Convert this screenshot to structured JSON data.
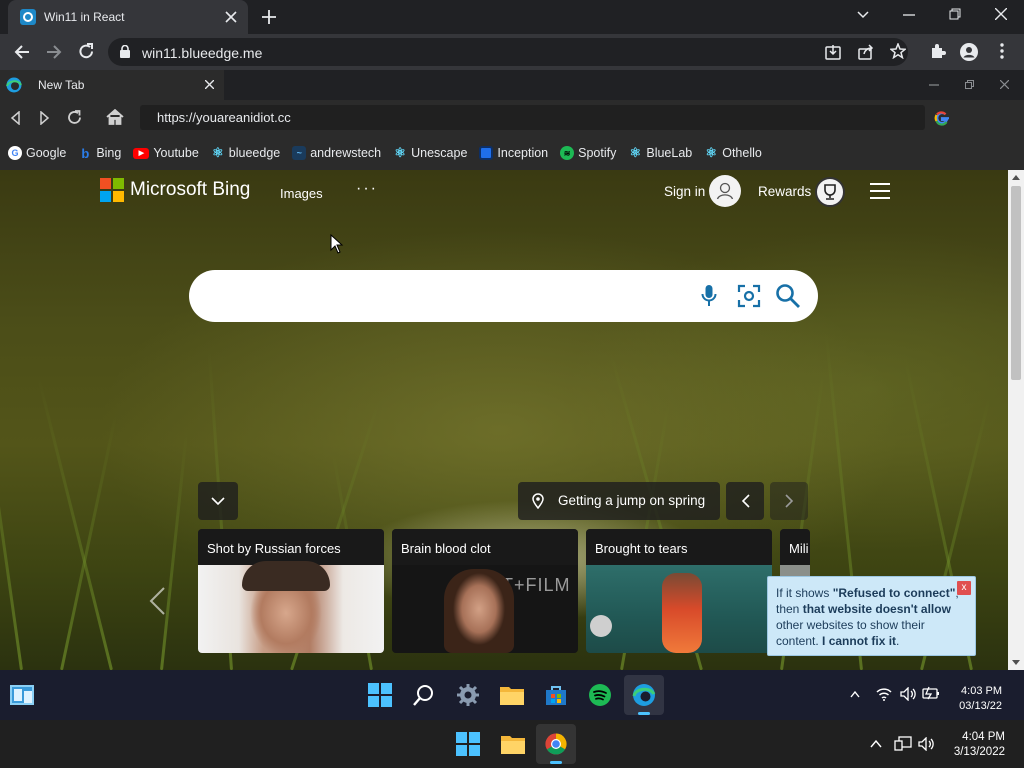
{
  "outer_browser": {
    "tab_title": "Win11 in React",
    "url": "win11.blueedge.me"
  },
  "inner_browser": {
    "tab_title": "New Tab",
    "address": "https://youareanidiot.cc",
    "bookmarks": [
      {
        "label": "Google",
        "icon": "google-icon",
        "color": "#ffffff"
      },
      {
        "label": "Bing",
        "icon": "bing-icon",
        "color": "#2b7de9"
      },
      {
        "label": "Youtube",
        "icon": "youtube-icon",
        "color": "#ff0000"
      },
      {
        "label": "blueedge",
        "icon": "react-icon",
        "color": "#61dafb"
      },
      {
        "label": "andrewstech",
        "icon": "andrewstech-icon",
        "color": "#2a8fd4"
      },
      {
        "label": "Unescape",
        "icon": "react-icon",
        "color": "#61dafb"
      },
      {
        "label": "Inception",
        "icon": "inception-icon",
        "color": "#1f6feb"
      },
      {
        "label": "Spotify",
        "icon": "spotify-icon",
        "color": "#1db954"
      },
      {
        "label": "BlueLab",
        "icon": "react-icon",
        "color": "#61dafb"
      },
      {
        "label": "Othello",
        "icon": "react-icon",
        "color": "#61dafb"
      }
    ]
  },
  "bing": {
    "brand": "Microsoft Bing",
    "nav_images": "Images",
    "nav_more": "···",
    "signin": "Sign in",
    "rewards": "Rewards",
    "caption": "Getting a jump on spring",
    "cards": [
      {
        "title": "Shot by Russian forces"
      },
      {
        "title": "Brain blood clot"
      },
      {
        "title": "Brought to tears"
      },
      {
        "title": "Mili"
      }
    ]
  },
  "tooltip": {
    "text1": "If it shows ",
    "bold1": "\"Refused to connect\"",
    "text2": ", then ",
    "bold2": "that website doesn't allow",
    "text3": " other websites to show their content. ",
    "bold3": "I cannot fix it",
    "text4": ".",
    "close": "x"
  },
  "inner_taskbar": {
    "time": "4:03 PM",
    "date": "03/13/22"
  },
  "outer_taskbar": {
    "time": "4:04 PM",
    "date": "3/13/2022"
  },
  "colors": {
    "accent": "#0078d4",
    "tooltip_bg": "#cde8f8"
  }
}
